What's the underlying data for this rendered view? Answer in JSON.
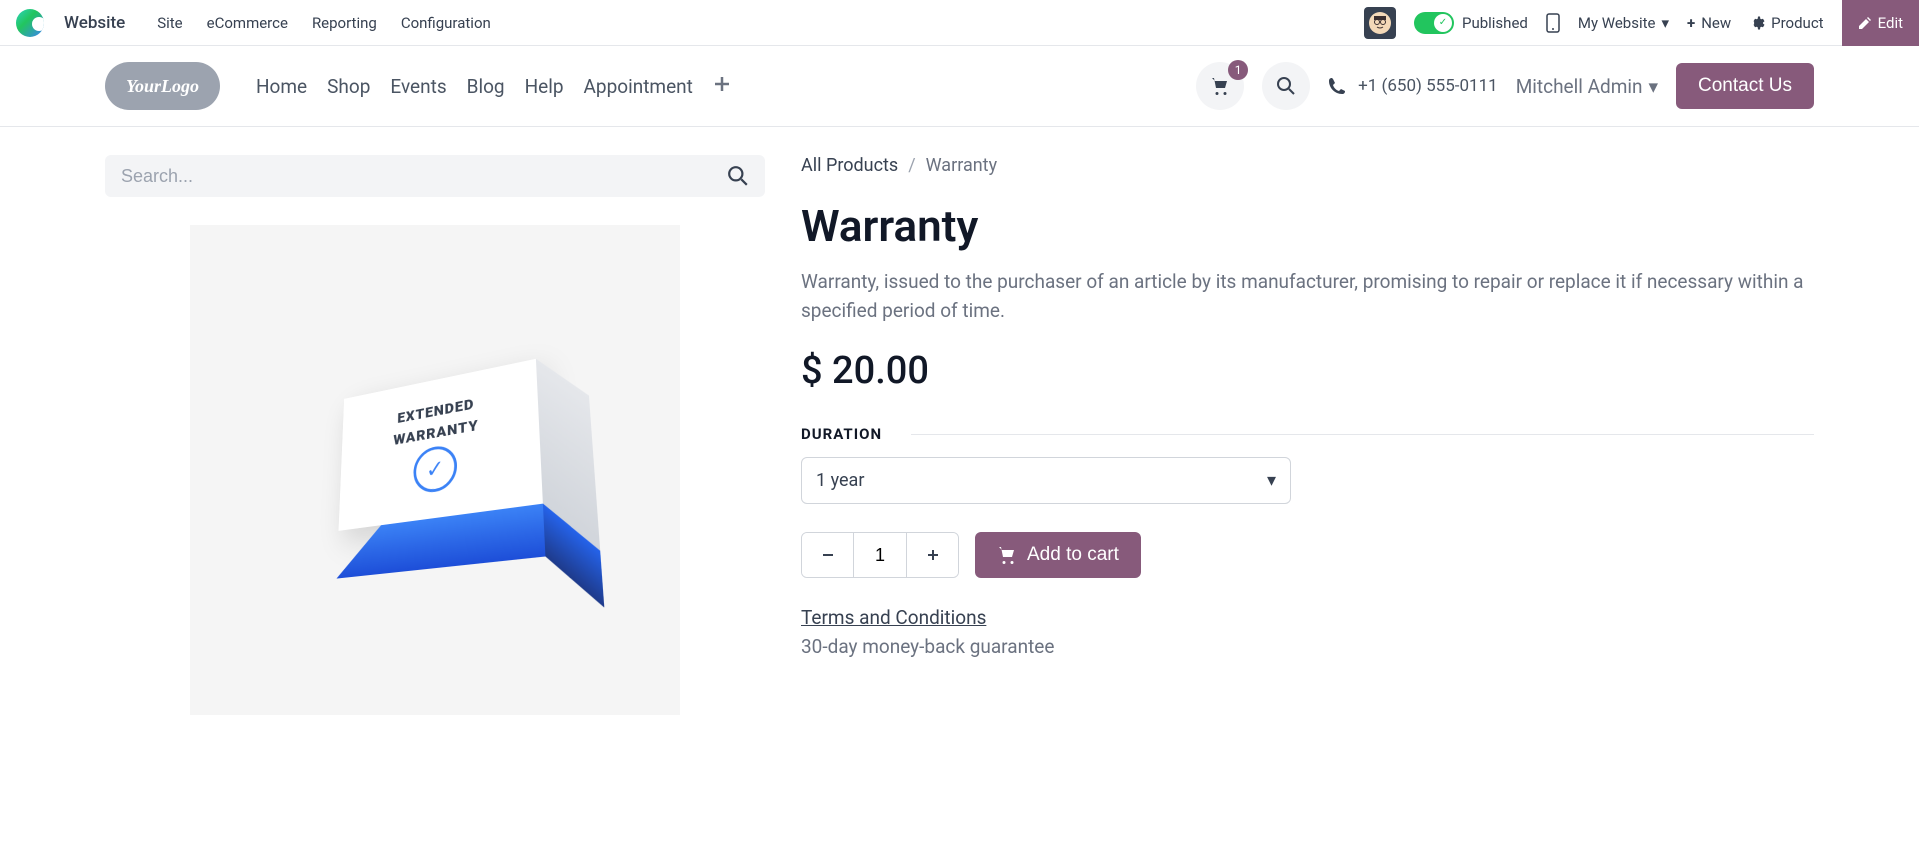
{
  "admin": {
    "app_name": "Website",
    "menu": [
      "Site",
      "eCommerce",
      "Reporting",
      "Configuration"
    ],
    "published_label": "Published",
    "my_website_label": "My Website",
    "new_label": "New",
    "product_label": "Product",
    "edit_label": "Edit"
  },
  "site_header": {
    "logo_text": "YourLogo",
    "nav": [
      "Home",
      "Shop",
      "Events",
      "Blog",
      "Help",
      "Appointment"
    ],
    "cart_count": "1",
    "phone": "+1 (650) 555-0111",
    "user_name": "Mitchell Admin",
    "contact_label": "Contact Us"
  },
  "search": {
    "placeholder": "Search..."
  },
  "breadcrumb": {
    "root": "All Products",
    "current": "Warranty"
  },
  "product": {
    "title": "Warranty",
    "description": "Warranty, issued to the purchaser of an article by its manufacturer, promising to repair or replace it if necessary within a specified period of time.",
    "price": "$ 20.00",
    "image_text_line1": "EXTENDED",
    "image_text_line2": "WARRANTY",
    "variant_label": "DURATION",
    "variant_selected": "1 year",
    "quantity": "1",
    "add_to_cart_label": "Add to cart",
    "terms_label": "Terms and Conditions",
    "guarantee_text": "30-day money-back guarantee"
  }
}
